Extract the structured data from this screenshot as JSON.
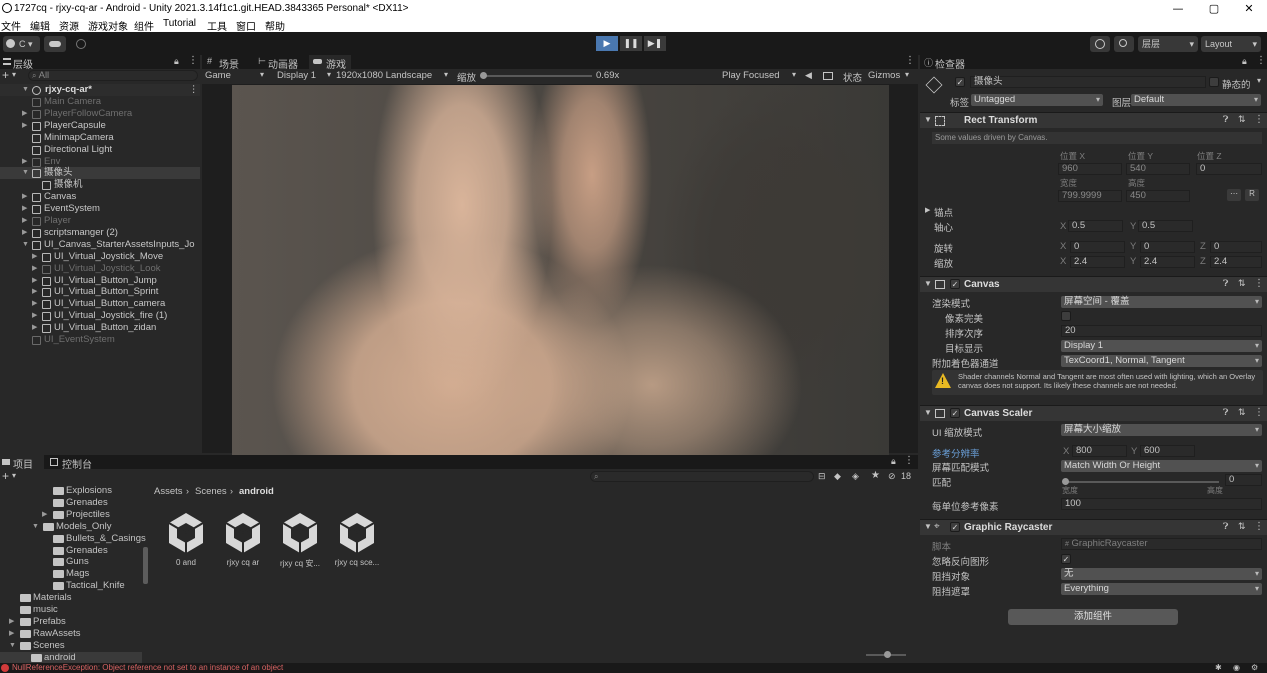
{
  "window": {
    "title": "1727cq - rjxy-cq-ar - Android - Unity 2021.3.14f1c1.git.HEAD.3843365 Personal* <DX11>",
    "controls": [
      "—",
      "▢",
      "✕"
    ]
  },
  "menu": [
    "文件",
    "编辑",
    "资源",
    "游戏对象",
    "组件",
    "Tutorial",
    "工具",
    "窗口",
    "帮助"
  ],
  "toolbar": {
    "account": "C ▾",
    "layers": "层层",
    "layout": "Layout",
    "play_buttons": [
      "▶",
      "❚❚",
      "▶❚"
    ]
  },
  "hierarchy": {
    "tab": "层级",
    "search_placeholder": "All",
    "scene": "rjxy-cq-ar*",
    "items": [
      {
        "label": "Main Camera",
        "dim": true
      },
      {
        "label": "PlayerFollowCamera",
        "dim": true
      },
      {
        "label": "PlayerCapsule",
        "dim": false
      },
      {
        "label": "MinimapCamera",
        "dim": false
      },
      {
        "label": "Directional Light",
        "dim": false
      },
      {
        "label": "Env",
        "dim": true
      },
      {
        "label": "摄像头",
        "dim": false
      },
      {
        "label": "摄像机",
        "dim": false
      },
      {
        "label": "Canvas",
        "dim": false
      },
      {
        "label": "EventSystem",
        "dim": false
      },
      {
        "label": "Player",
        "dim": true
      },
      {
        "label": "scriptsmanger (2)",
        "dim": false
      },
      {
        "label": "UI_Canvas_StarterAssetsInputs_Jo",
        "dim": false
      },
      {
        "label": "UI_Virtual_Joystick_Move",
        "dim": false
      },
      {
        "label": "UI_Virtual_Joystick_Look",
        "dim": true
      },
      {
        "label": "UI_Virtual_Button_Jump",
        "dim": false
      },
      {
        "label": "UI_Virtual_Button_Sprint",
        "dim": false
      },
      {
        "label": "UI_Virtual_Button_camera",
        "dim": false
      },
      {
        "label": "UI_Virtual_Joystick_fire (1)",
        "dim": false
      },
      {
        "label": "UI_Virtual_Button_zidan",
        "dim": false
      },
      {
        "label": "UI_EventSystem",
        "dim": true
      }
    ]
  },
  "scene_tabs": [
    "场景",
    "动画器",
    "游戏"
  ],
  "game_toolbar": {
    "view": "Game",
    "display": "Display 1",
    "resolution": "1920x1080 Landscape",
    "scale_label": "缩放",
    "scale_value": "0.69x",
    "play_focused": "Play Focused",
    "stats": "状态",
    "gizmos": "Gizmos"
  },
  "inspector": {
    "tab": "检查器",
    "object_name": "摄像头",
    "static_label": "静态的",
    "tag_label": "标签",
    "tag": "Untagged",
    "layer_label": "图层",
    "layer": "Default",
    "rect_transform": {
      "title": "Rect Transform",
      "note": "Some values driven by Canvas.",
      "pos_labels": [
        "位置 X",
        "位置 Y",
        "位置 Z"
      ],
      "pos_values": [
        "960",
        "540",
        "0"
      ],
      "size_labels": [
        "宽度",
        "高度"
      ],
      "size_values": [
        "799.9999",
        "450"
      ],
      "anchor_label": "锚点",
      "pivot_label": "轴心",
      "pivot": [
        "0.5",
        "0.5"
      ],
      "rotation_label": "旋转",
      "rotation": [
        "0",
        "0",
        "0"
      ],
      "scale_label": "缩放",
      "scale": [
        "2.4",
        "2.4",
        "2.4"
      ],
      "r_button": "R"
    },
    "canvas": {
      "title": "Canvas",
      "render_mode_label": "渲染模式",
      "render_mode": "屏幕空间 - 覆盖",
      "pixel_perfect_label": "像素完美",
      "sort_order_label": "排序次序",
      "sort_order": "20",
      "target_display_label": "目标显示",
      "target_display": "Display 1",
      "shader_channels_label": "附加着色器通道",
      "shader_channels": "TexCoord1, Normal, Tangent",
      "warning": "Shader channels Normal and Tangent are most often used with lighting, which an Overlay canvas does not support. Its likely these channels are not needed."
    },
    "canvas_scaler": {
      "title": "Canvas Scaler",
      "ui_scale_mode_label": "UI 缩放模式",
      "ui_scale_mode": "屏幕大小缩放",
      "reference_label": "参考分辨率",
      "reference": [
        "800",
        "600"
      ],
      "match_mode_label": "屏幕匹配模式",
      "match_mode": "Match Width Or Height",
      "match_label": "匹配",
      "match_value": "0",
      "match_ends": [
        "宽度",
        "高度"
      ],
      "ppu_label": "每单位参考像素",
      "ppu": "100"
    },
    "graphic_raycaster": {
      "title": "Graphic Raycaster",
      "script_label": "脚本",
      "script": "GraphicRaycaster",
      "ignore_reversed_label": "忽略反向图形",
      "blocking_objects_label": "阻挡对象",
      "blocking_objects": "无",
      "blocking_mask_label": "阻挡遮罩",
      "blocking_mask": "Everything"
    },
    "add_component": "添加组件"
  },
  "project": {
    "tabs": [
      "项目",
      "控制台"
    ],
    "tree": [
      {
        "label": "Explosions",
        "indent": 2
      },
      {
        "label": "Grenades",
        "indent": 2
      },
      {
        "label": "Projectiles",
        "indent": 2
      },
      {
        "label": "Models_Only",
        "indent": 1
      },
      {
        "label": "Bullets_&_Casings",
        "indent": 2
      },
      {
        "label": "Grenades",
        "indent": 2
      },
      {
        "label": "Guns",
        "indent": 2
      },
      {
        "label": "Mags",
        "indent": 2
      },
      {
        "label": "Tactical_Knife",
        "indent": 2
      },
      {
        "label": "Materials",
        "indent": 0
      },
      {
        "label": "music",
        "indent": 0
      },
      {
        "label": "Prefabs",
        "indent": 0
      },
      {
        "label": "RawAssets",
        "indent": 0
      },
      {
        "label": "Scenes",
        "indent": 0
      },
      {
        "label": "android",
        "indent": 1
      }
    ],
    "breadcrumb": [
      "Assets",
      "Scenes",
      "android"
    ],
    "assets": [
      "0 and",
      "rjxy cq ar",
      "rjxy cq 安...",
      "rjxy cq sce..."
    ],
    "count_badge": "18"
  },
  "status": {
    "error": "NullReferenceException: Object reference not set to an instance of an object"
  }
}
